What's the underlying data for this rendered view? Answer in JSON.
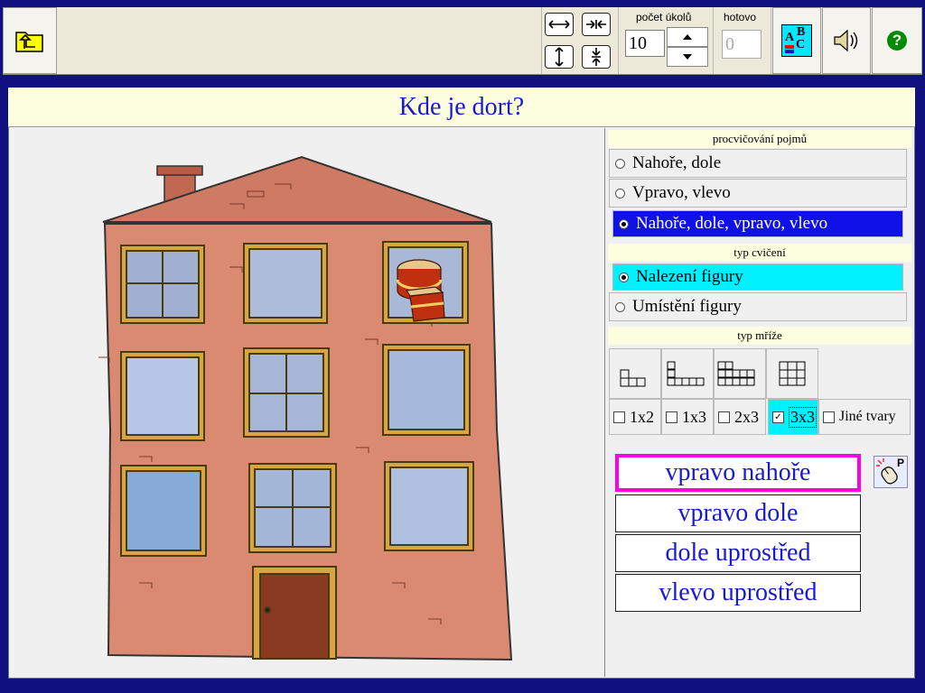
{
  "toolbar": {
    "back_icon": "folder-up-icon",
    "arrow_buttons": [
      {
        "name": "widen-horizontal-button",
        "glyph": "↔"
      },
      {
        "name": "narrow-horizontal-button",
        "glyph": "→←"
      },
      {
        "name": "widen-vertical-button",
        "glyph": "↕"
      },
      {
        "name": "narrow-vertical-button",
        "glyph": "⇣"
      }
    ],
    "task_count_label": "počet úkolů",
    "task_count_value": "10",
    "done_label": "hotovo",
    "done_value": "0",
    "abc_label_a": "A",
    "abc_label_b": "B",
    "abc_label_c": "C",
    "help_glyph": "?"
  },
  "title": "Kde je dort?",
  "side": {
    "concepts_heading": "procvičování pojmů",
    "concepts": [
      {
        "label": "Nahoře, dole",
        "selected": false
      },
      {
        "label": "Vpravo, vlevo",
        "selected": false
      },
      {
        "label": "Nahoře, dole, vpravo, vlevo",
        "selected": true
      }
    ],
    "exercise_heading": "typ cvičení",
    "exercise_types": [
      {
        "label": "Nalezení figury",
        "selected": true
      },
      {
        "label": "Umístění figury",
        "selected": false
      }
    ],
    "grid_heading": "typ mříže",
    "grid_options": [
      {
        "label": "1x2",
        "checked": false
      },
      {
        "label": "1x3",
        "checked": false
      },
      {
        "label": "2x3",
        "checked": false
      },
      {
        "label": "3x3",
        "checked": true
      },
      {
        "label": "Jiné tvary",
        "checked": false
      }
    ],
    "print_letter": "P"
  },
  "answers": [
    {
      "label": "vpravo nahoře",
      "selected": true
    },
    {
      "label": "vpravo dole",
      "selected": false
    },
    {
      "label": "dole uprostřed",
      "selected": false
    },
    {
      "label": "vlevo uprostřed",
      "selected": false
    }
  ],
  "colors": {
    "frame": "#101080",
    "title_bg": "#fdfde0",
    "title_text": "#1a1acc",
    "selected_blue": "#1010e8",
    "selected_cyan": "#00f0ff",
    "answer_highlight": "#ff00e0"
  }
}
